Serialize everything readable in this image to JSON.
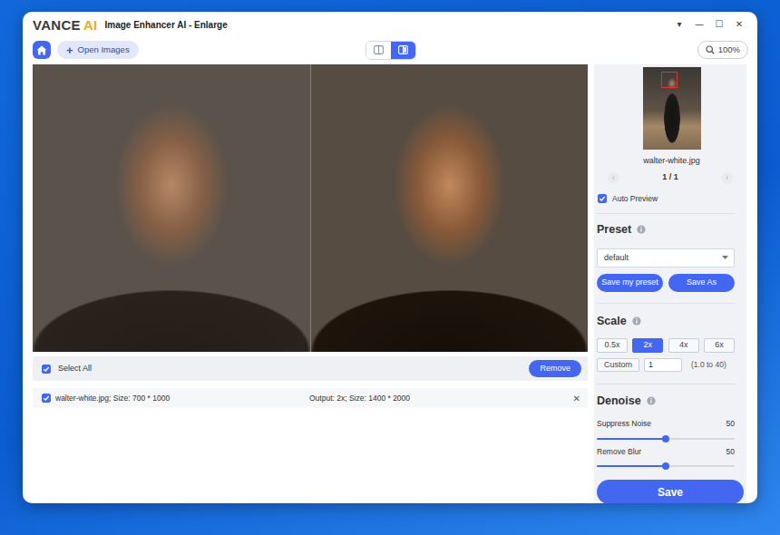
{
  "window": {
    "logo": {
      "brand": "VANCE",
      "accent": "AI"
    },
    "title": "Image Enhancer AI - Enlarge",
    "controls": [
      "▾",
      "—",
      "☐",
      "✕"
    ]
  },
  "toolbar": {
    "open_button": {
      "icon": "+",
      "label": "Open Images"
    },
    "views": [
      {
        "kind": "single",
        "selected": false
      },
      {
        "kind": "split",
        "selected": true
      }
    ],
    "zoom": "100%"
  },
  "file_list": {
    "select_all": {
      "label": "Select All",
      "checked": true
    },
    "remove_button": "Remove",
    "rows": [
      {
        "checked": true,
        "file": "walter-white.jpg; Size: 700 * 1000",
        "output": "Output: 2x; Size: 1400 * 2000",
        "remove_icon": "✕"
      }
    ]
  },
  "sidebar": {
    "thumbnail": {
      "filename": "walter-white.jpg"
    },
    "pager": {
      "prev": {
        "icon": "‹",
        "disabled": true
      },
      "page": "1 / 1",
      "next": {
        "icon": "›",
        "disabled": true
      }
    },
    "auto_preview": {
      "label": "Auto Preview",
      "checked": true
    },
    "preset": {
      "title": "Preset",
      "value": "default",
      "buttons": [
        "Save my preset",
        "Save As"
      ]
    },
    "scale": {
      "title": "Scale",
      "options": [
        {
          "label": "0.5x",
          "selected": false
        },
        {
          "label": "2x",
          "selected": true
        },
        {
          "label": "4x",
          "selected": false
        },
        {
          "label": "6x",
          "selected": false
        }
      ],
      "custom": {
        "label": "Custom",
        "value": "1",
        "range": "(1.0 to 40)"
      }
    },
    "denoise": {
      "title": "Denoise",
      "sliders": [
        {
          "label": "Suppress Noise",
          "reading": "50",
          "level": 0.5
        },
        {
          "label": "Remove Blur",
          "reading": "50",
          "level": 0.5
        }
      ]
    },
    "save_button": "Save"
  }
}
